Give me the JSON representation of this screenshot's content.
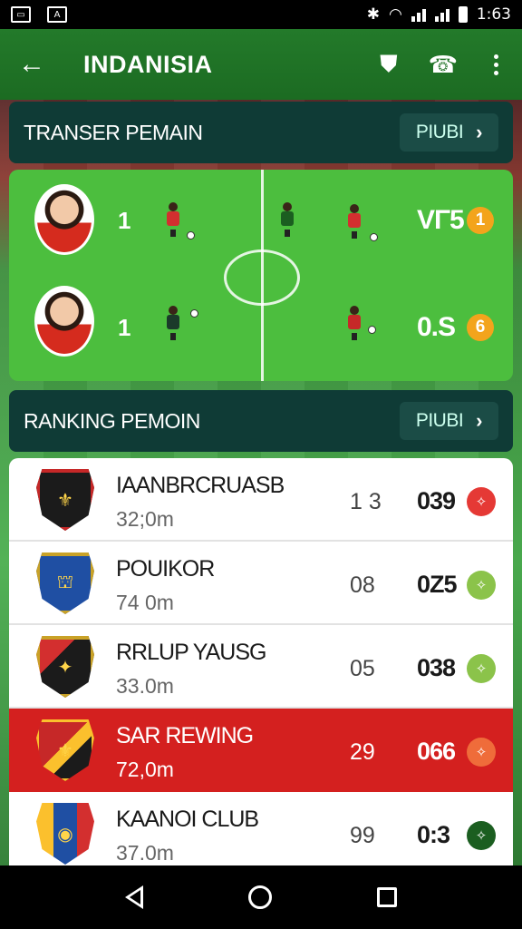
{
  "status_bar": {
    "time": "1:63"
  },
  "app_bar": {
    "title": "INDANISIA"
  },
  "transfer_section": {
    "title": "TRANSER PEMAIN",
    "action_label": "PIUBI"
  },
  "transfer_rows": [
    {
      "number": "1",
      "score": "VΓ5",
      "badge": "1"
    },
    {
      "number": "1",
      "score": "0.S",
      "badge": "6"
    }
  ],
  "ranking_section": {
    "title": "RANKING PEMOIN",
    "action_label": "PIUBI"
  },
  "clubs": [
    {
      "name": "IAANBRCRUASB",
      "value": "32;0m",
      "col_a": "1 3",
      "col_b": "039",
      "badge_color": "#e53935",
      "crest_color": "#1b1b1b"
    },
    {
      "name": "POUIKOR",
      "value": "74 0m",
      "col_a": "08",
      "col_b": "0Z5",
      "badge_color": "#8bc34a",
      "crest_color": "#1f4fa3"
    },
    {
      "name": "RRLUP YAUSG",
      "value": "33.0m",
      "col_a": "05",
      "col_b": "038",
      "badge_color": "#8bc34a",
      "crest_color": "#1b1b1b"
    },
    {
      "name": "SAR REWING",
      "value": "72,0m",
      "col_a": "29",
      "col_b": "066",
      "badge_color": "#ef6c3a",
      "crest_color": "#c62828"
    },
    {
      "name": "KAANOI CLUB",
      "value": "37.0m",
      "col_a": "99",
      "col_b": "0:3",
      "badge_color": "#1b5e20",
      "crest_color": "#1f4fa3"
    }
  ],
  "colors": {
    "app_bar": "#1c6b22",
    "section_header": "#0f3b36",
    "highlight_row": "#d4201f",
    "coin": "#f3a41c"
  }
}
